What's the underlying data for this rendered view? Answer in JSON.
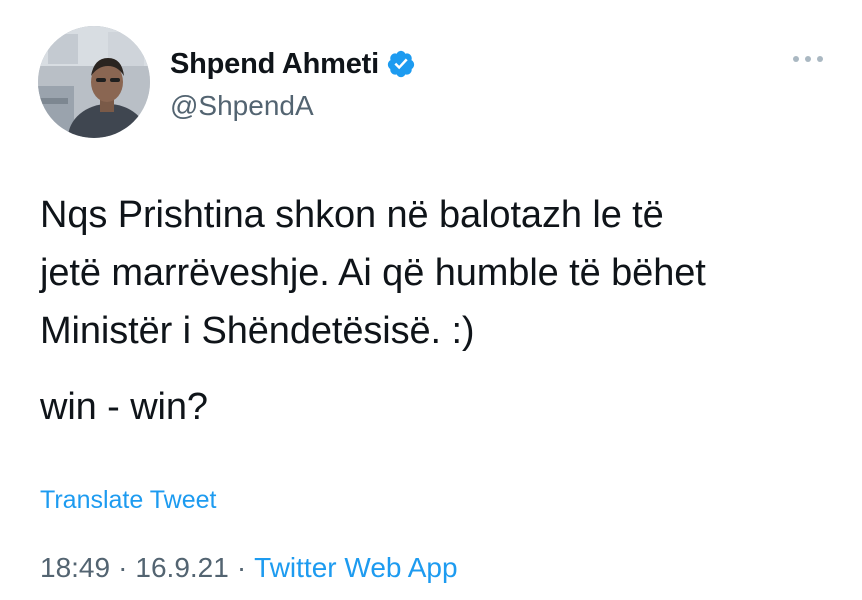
{
  "author": {
    "display_name": "Shpend Ahmeti",
    "handle": "@ShpendA",
    "verified": true,
    "avatar_icon": "profile-photo"
  },
  "tweet": {
    "text_paragraph_1_line_1": "Nqs Prishtina shkon në balotazh le të",
    "text_paragraph_1_line_2": "jetë marrëveshje. Ai që humble të bëhet",
    "text_paragraph_1_line_3": "Ministër i Shëndetësisë. :)",
    "text_paragraph_2": "win - win?",
    "translate_label": "Translate Tweet"
  },
  "meta": {
    "time": "18:49",
    "date": "16.9.21",
    "separator": "·",
    "source": "Twitter Web App"
  },
  "icons": {
    "more": "more-horizontal-icon",
    "verified": "verified-badge-icon"
  },
  "colors": {
    "accent": "#1d9bf0",
    "text": "#0f1419",
    "secondary": "#536471"
  }
}
